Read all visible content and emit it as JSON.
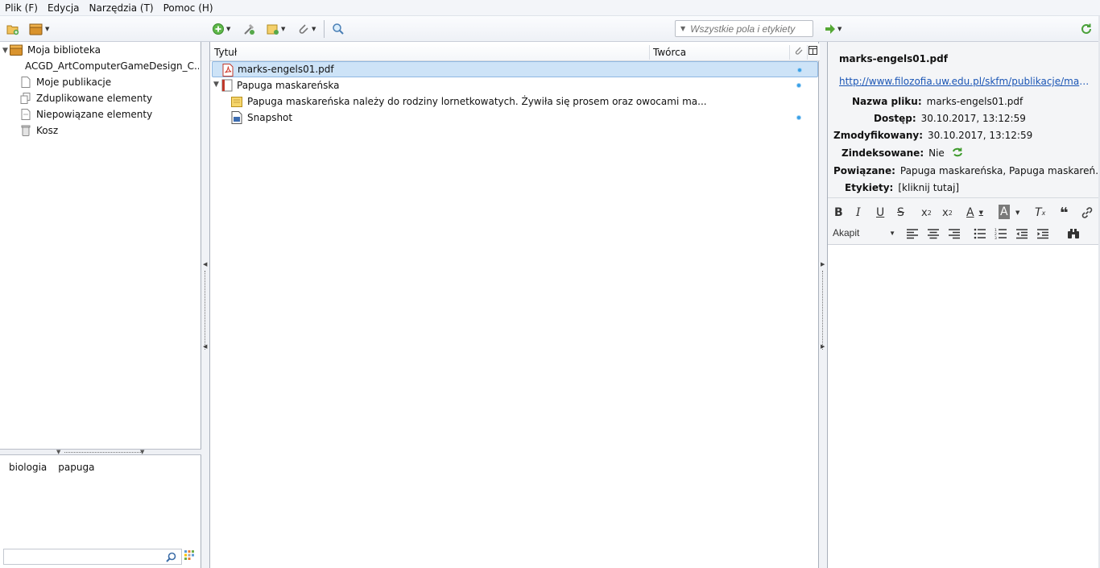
{
  "menu": [
    "Plik (F)",
    "Edycja",
    "Narzędzia (T)",
    "Pomoc (H)"
  ],
  "toolbar": {
    "search_placeholder": "Wszystkie pola i etykiety",
    "icons": [
      "new-collection-icon",
      "new-library-icon",
      "new-item-icon",
      "add-by-identifier-icon",
      "new-note-icon",
      "attachment-icon",
      "advanced-search-icon",
      "locate-icon",
      "sync-icon"
    ]
  },
  "library": {
    "root": "Moja biblioteka",
    "items": [
      {
        "label": "ACGD_ArtComputerGameDesign_C...",
        "icon": "folder-icon"
      },
      {
        "label": "Moje publikacje",
        "icon": "document-icon"
      },
      {
        "label": "Zduplikowane elementy",
        "icon": "duplicate-icon"
      },
      {
        "label": "Niepowiązane elementy",
        "icon": "unfiled-icon"
      },
      {
        "label": "Kosz",
        "icon": "trash-icon"
      }
    ]
  },
  "tags": [
    "biologia",
    "papuga"
  ],
  "columns": {
    "title": "Tytuł",
    "creator": "Twórca"
  },
  "items": [
    {
      "title": "marks-engels01.pdf",
      "icon": "pdf-icon",
      "selected": true
    },
    {
      "title": "Papuga maskareńska",
      "icon": "book-icon"
    },
    {
      "title": "Papuga maskareńska należy do rodziny lornetkowatych. Żywiła się prosem oraz owocami ma...",
      "icon": "note-icon"
    },
    {
      "title": "Snapshot",
      "icon": "snapshot-icon"
    }
  ],
  "details": {
    "title": "marks-engels01.pdf",
    "url": "http://www.filozofia.uw.edu.pl/skfm/publikacje/marks-e...",
    "fields": {
      "filename_label": "Nazwa pliku:",
      "filename": "marks-engels01.pdf",
      "accessed_label": "Dostęp:",
      "accessed": "30.10.2017, 13:12:59",
      "modified_label": "Zmodyfikowany:",
      "modified": "30.10.2017, 13:12:59",
      "indexed_label": "Zindeksowane:",
      "indexed": "Nie",
      "related_label": "Powiązane:",
      "related": "Papuga maskareńska, Papuga maskareńska na...",
      "tags_label": "Etykiety:",
      "tags": "[kliknij tutaj]"
    }
  },
  "editor": {
    "paragraph": "Akapit"
  }
}
